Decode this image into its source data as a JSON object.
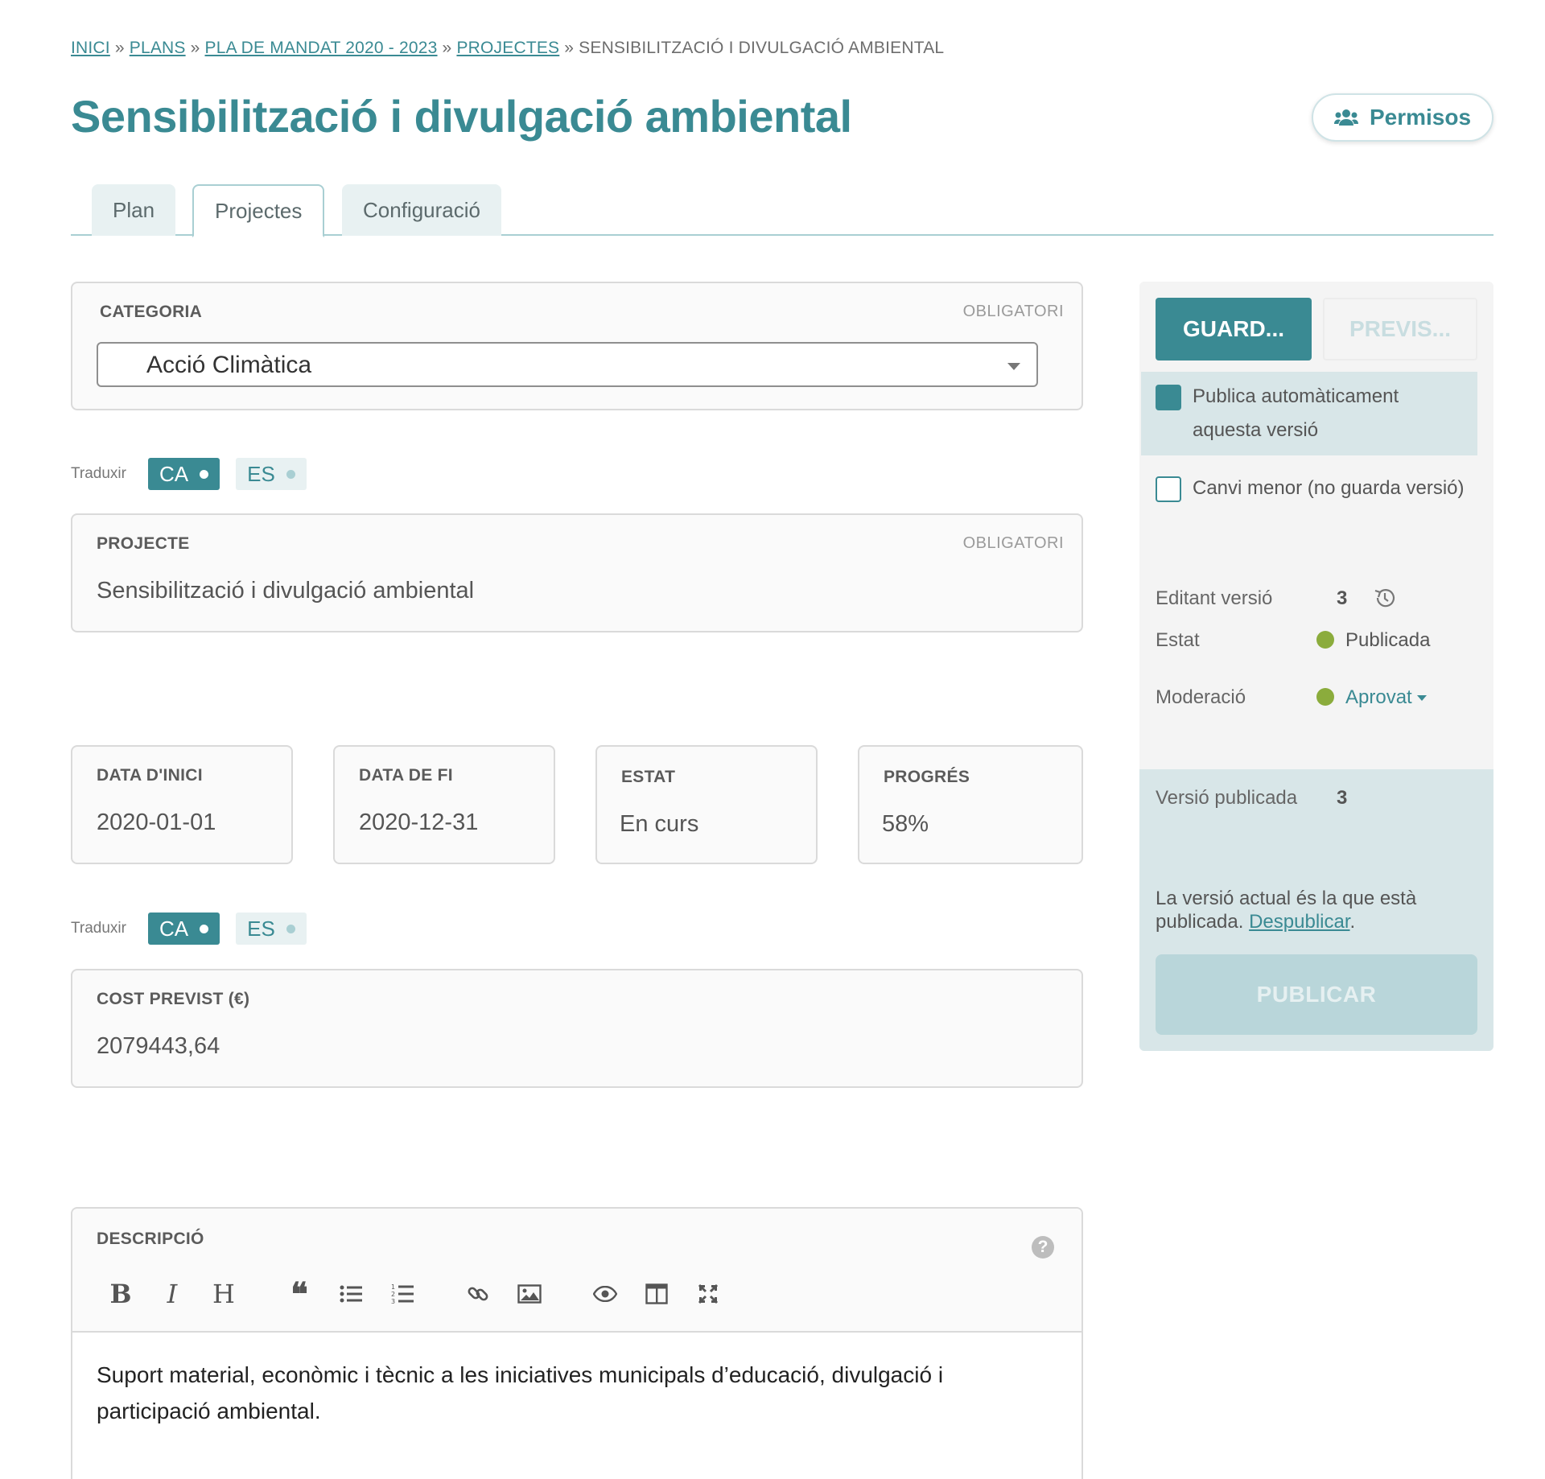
{
  "breadcrumb": {
    "items": [
      "INICI",
      "PLANS",
      "PLA DE MANDAT 2020 - 2023",
      "PROJECTES"
    ],
    "separator": "»",
    "current": "SENSIBILITZACIÓ I DIVULGACIÓ AMBIENTAL"
  },
  "page_title": "Sensibilització i divulgació ambiental",
  "permissions_button": {
    "label": "Permisos",
    "icon": "users-icon"
  },
  "tabs": [
    {
      "label": "Plan",
      "active": false
    },
    {
      "label": "Projectes",
      "active": true
    },
    {
      "label": "Configuració",
      "active": false
    }
  ],
  "required_label": "OBLIGATORI",
  "category": {
    "label": "CATEGORIA",
    "value": "Acció Climàtica"
  },
  "translate": {
    "label": "Traduxir",
    "langs": [
      "CA",
      "ES"
    ],
    "active": "CA"
  },
  "project": {
    "label": "PROJECTE",
    "value": "Sensibilització i divulgació ambiental"
  },
  "start_date": {
    "label": "DATA D'INICI",
    "value": "2020-01-01"
  },
  "end_date": {
    "label": "DATA DE FI",
    "value": "2020-12-31"
  },
  "status": {
    "label": "ESTAT",
    "value": "En curs"
  },
  "progress": {
    "label": "PROGRÉS",
    "value": "58%"
  },
  "cost": {
    "label": "COST PREVIST (€)",
    "value": "2079443,64"
  },
  "description": {
    "label": "DESCRIPCIÓ",
    "text": "Suport material, econòmic i tècnic a les iniciatives municipals d’educació, divulgació i participació ambiental.",
    "toolbar": [
      "bold-icon",
      "italic-icon",
      "heading-icon",
      "quote-icon",
      "unordered-list-icon",
      "ordered-list-icon",
      "link-icon",
      "image-icon",
      "preview-icon",
      "side-by-side-icon",
      "fullscreen-icon"
    ]
  },
  "sidebar": {
    "save_label": "GUARD...",
    "preview_label": "PREVIS...",
    "auto_publish": {
      "label": "Publica automàticament aquesta versió",
      "checked": true
    },
    "minor_change": {
      "label": "Canvi menor (no guarda versió)",
      "checked": false
    },
    "editing_version": {
      "label": "Editant versió",
      "value": "3"
    },
    "state": {
      "label": "Estat",
      "value": "Publicada"
    },
    "moderation": {
      "label": "Moderació",
      "value": "Aprovat"
    },
    "published_version": {
      "label": "Versió publicada",
      "value": "3"
    },
    "published_note": "La versió actual és la que està publicada.",
    "unpublish_link": "Despublicar",
    "publish_label": "PUBLICAR"
  },
  "colors": {
    "accent": "#3a8a93",
    "status_ok": "#8bac3c",
    "panel": "#d8e6e8"
  }
}
